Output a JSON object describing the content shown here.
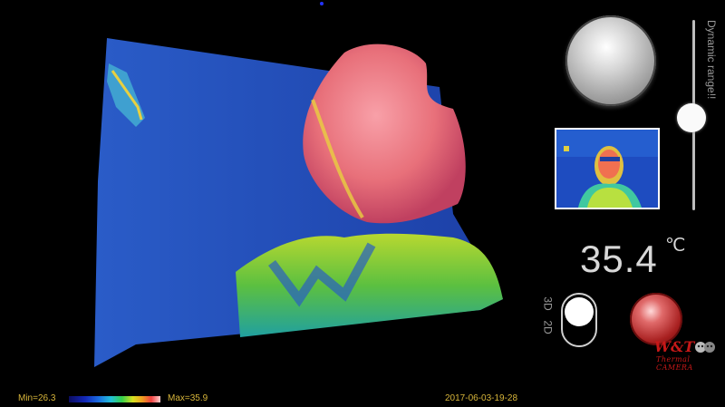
{
  "range_slider": {
    "label": "Dynamic range!!",
    "value_fraction": 0.45
  },
  "temperature": {
    "value": "35.4",
    "unit": "℃"
  },
  "mode_toggle": {
    "option_3d": "3D",
    "option_2d": "2D",
    "selected": "3D"
  },
  "logo": {
    "brand": "W&T",
    "subtitle": "Thermal CAMERA"
  },
  "footer": {
    "min": "Min=26.3",
    "max": "Max=35.9",
    "timestamp": "2017-06-03-19-28"
  },
  "colors": {
    "accent_text": "#d7b53a",
    "record": "#b02020",
    "logo": "#c61818"
  },
  "icons": {
    "shutter": "shutter-button-icon",
    "record": "record-button-icon"
  }
}
